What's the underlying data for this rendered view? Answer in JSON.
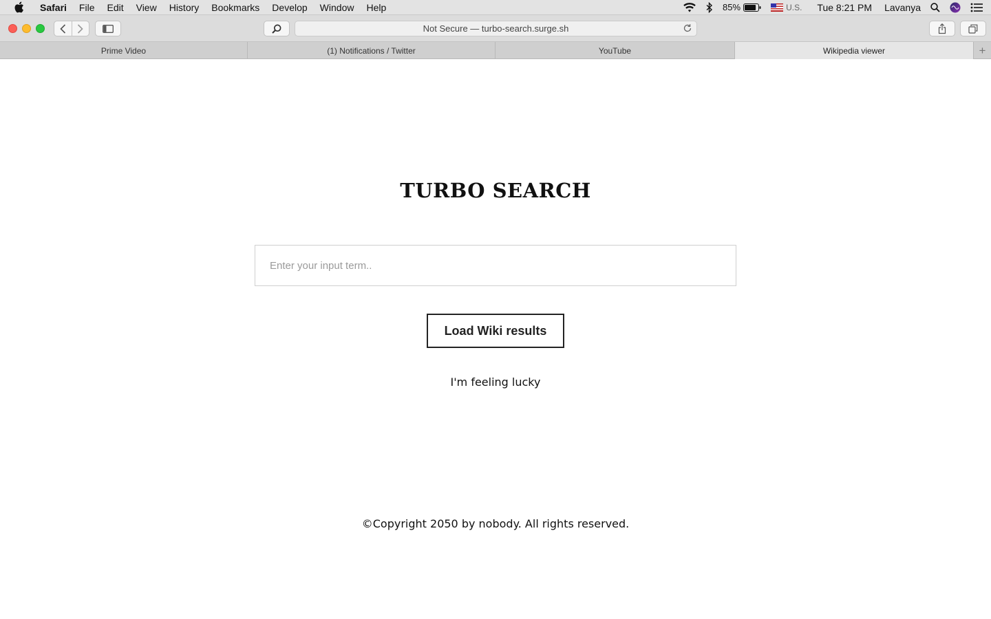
{
  "menubar": {
    "apple_icon": "apple-icon",
    "items": [
      "Safari",
      "File",
      "Edit",
      "View",
      "History",
      "Bookmarks",
      "Develop",
      "Window",
      "Help"
    ],
    "status": {
      "wifi_icon": "wifi-icon",
      "bluetooth_icon": "bluetooth-icon",
      "battery_percent": "85%",
      "battery_level": 0.85,
      "input_source": "U.S.",
      "clock": "Tue 8:21 PM",
      "user": "Lavanya"
    }
  },
  "toolbar": {
    "address": "Not Secure — turbo-search.surge.sh"
  },
  "tabs": [
    {
      "label": "Prime Video",
      "active": false
    },
    {
      "label": "(1) Notifications / Twitter",
      "active": false
    },
    {
      "label": "YouTube",
      "active": false
    },
    {
      "label": "Wikipedia viewer",
      "active": true
    }
  ],
  "page": {
    "title": "TURBO SEARCH",
    "search_placeholder": "Enter your input term..",
    "search_value": "",
    "load_button": "Load Wiki results",
    "lucky_link": "I'm feeling lucky",
    "copyright": "©Copyright 2050 by nobody. All rights reserved."
  },
  "colors": {
    "close": "#fc5f57",
    "minimize": "#fdbc2e",
    "zoom": "#28c840"
  }
}
